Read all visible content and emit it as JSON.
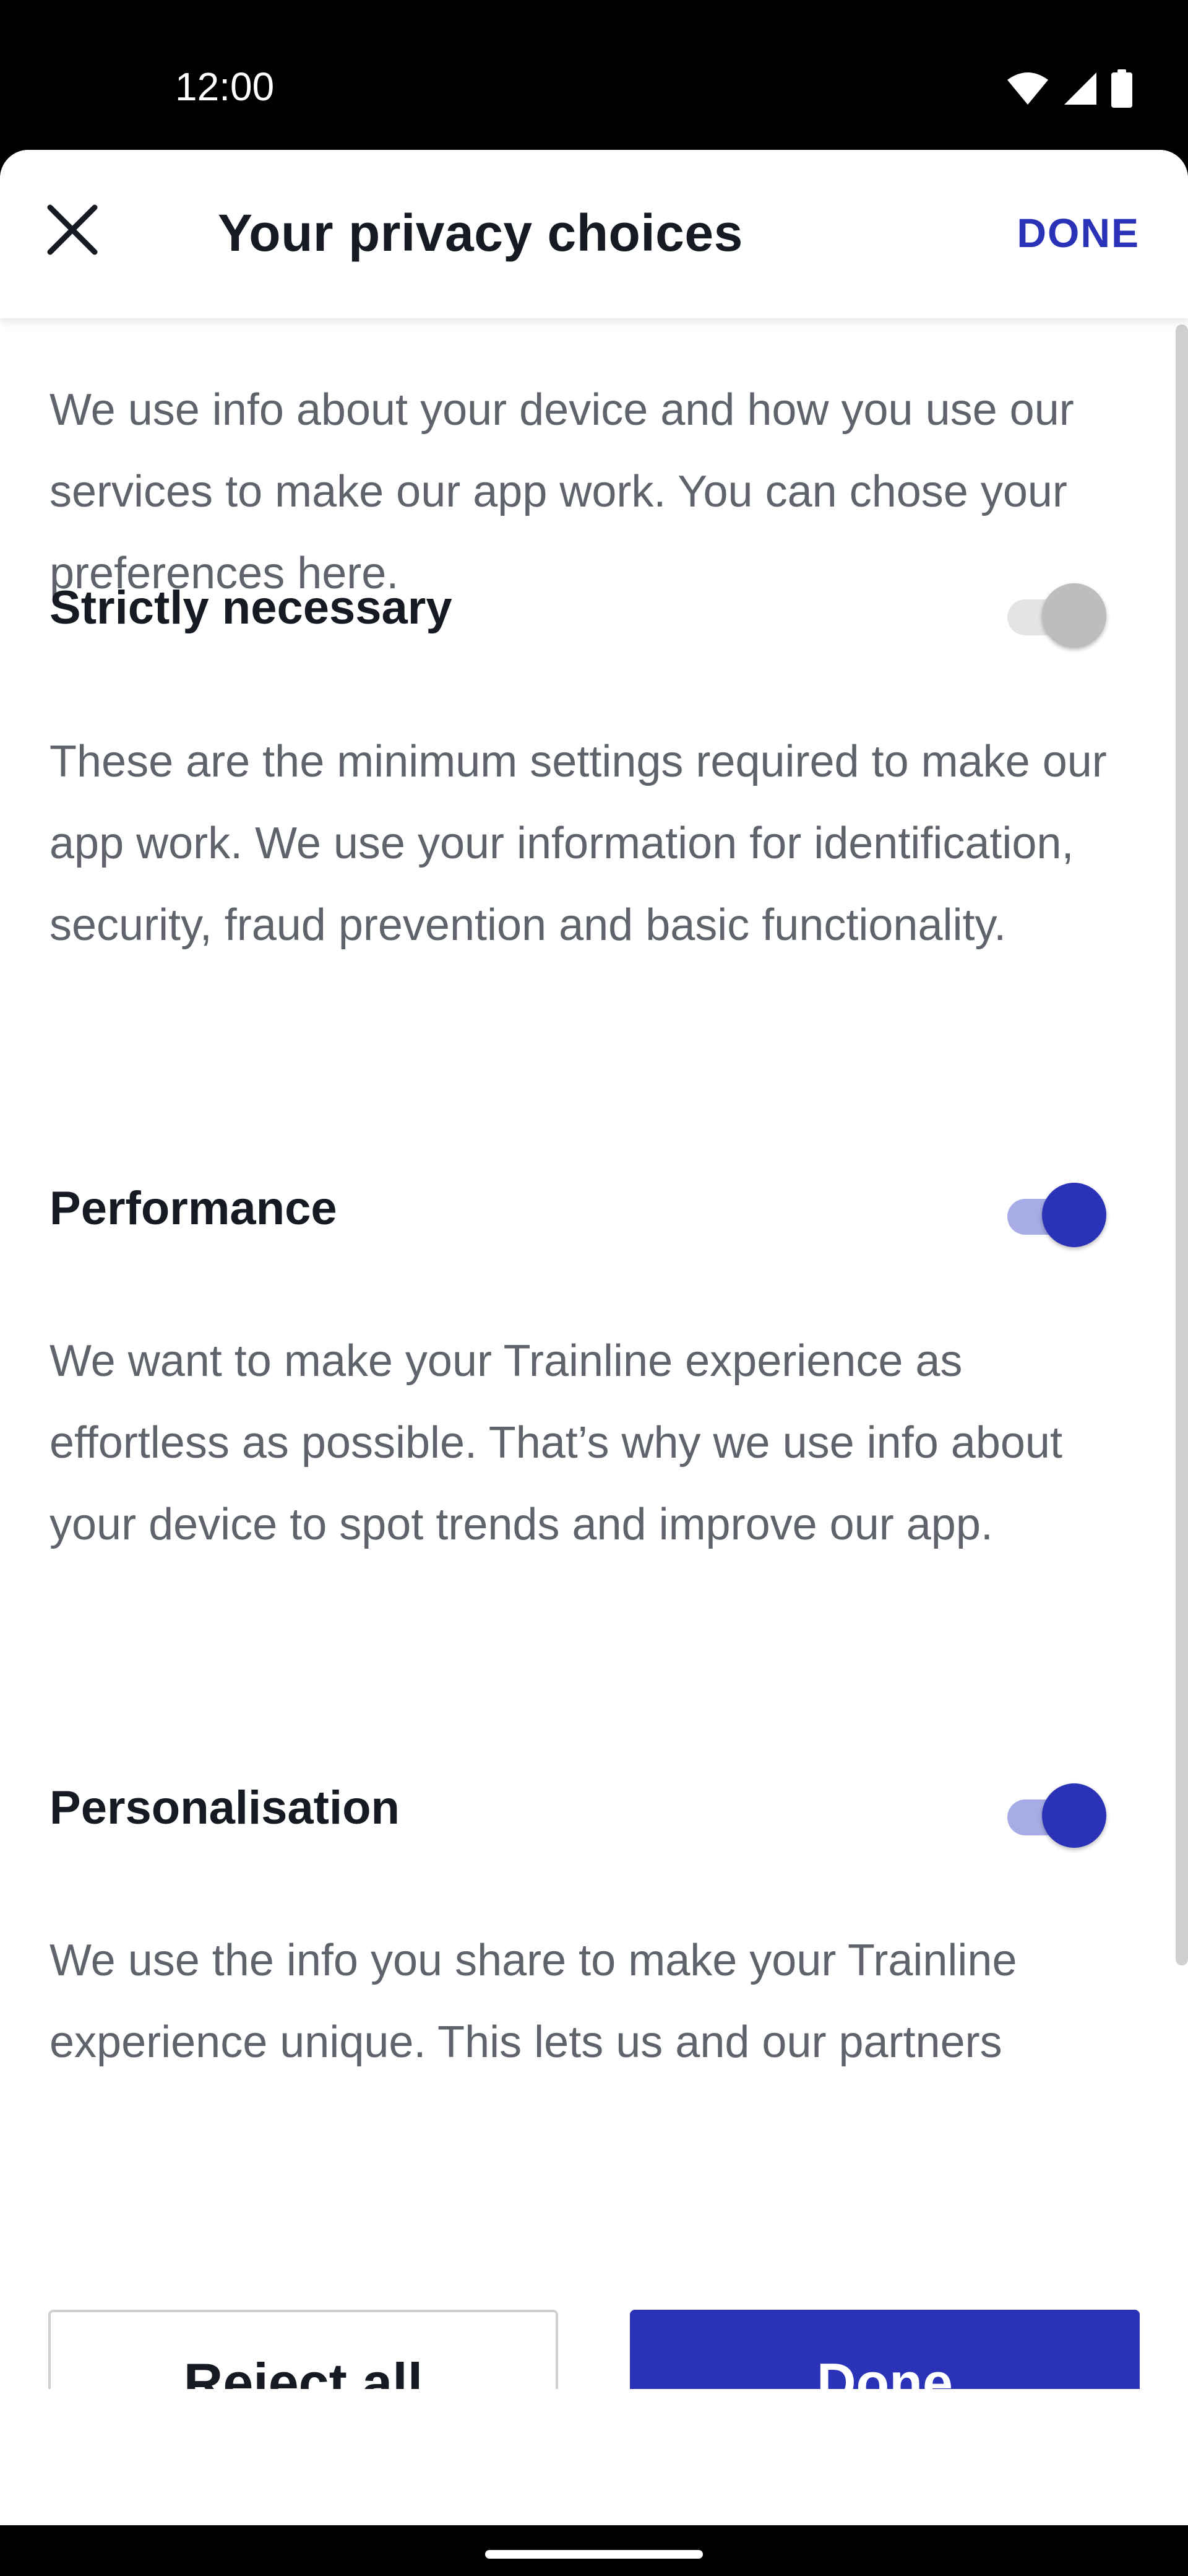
{
  "status_bar": {
    "time": "12:00",
    "icons": [
      "wifi-icon",
      "signal-icon",
      "battery-icon"
    ]
  },
  "header": {
    "title": "Your privacy choices",
    "done_label": "DONE",
    "close_icon": "close-icon"
  },
  "intro": "We use info about your device and how you use our services to make our app work. You can chose your preferences here.",
  "sections": [
    {
      "title": "Strictly necessary",
      "toggle_on": true,
      "toggle_enabled": false,
      "description": "These are the minimum settings required to make our app work. We use your information for identification, security, fraud prevention and basic functionality."
    },
    {
      "title": "Performance",
      "toggle_on": true,
      "toggle_enabled": true,
      "description": "We want to make your Trainline experience as effortless as possible. That’s why we use info about your device to spot trends and improve our app."
    },
    {
      "title": "Personalisation",
      "toggle_on": true,
      "toggle_enabled": true,
      "description": "We use the info you share to make your Trainline experience unique. This lets us and our partners"
    }
  ],
  "actions": {
    "reject_label": "Reject all",
    "done_label": "Done"
  },
  "colors": {
    "accent": "#2a33b8",
    "accent_track": "#a7ace6",
    "text_primary": "#151a23",
    "text_secondary": "#5f646c"
  }
}
